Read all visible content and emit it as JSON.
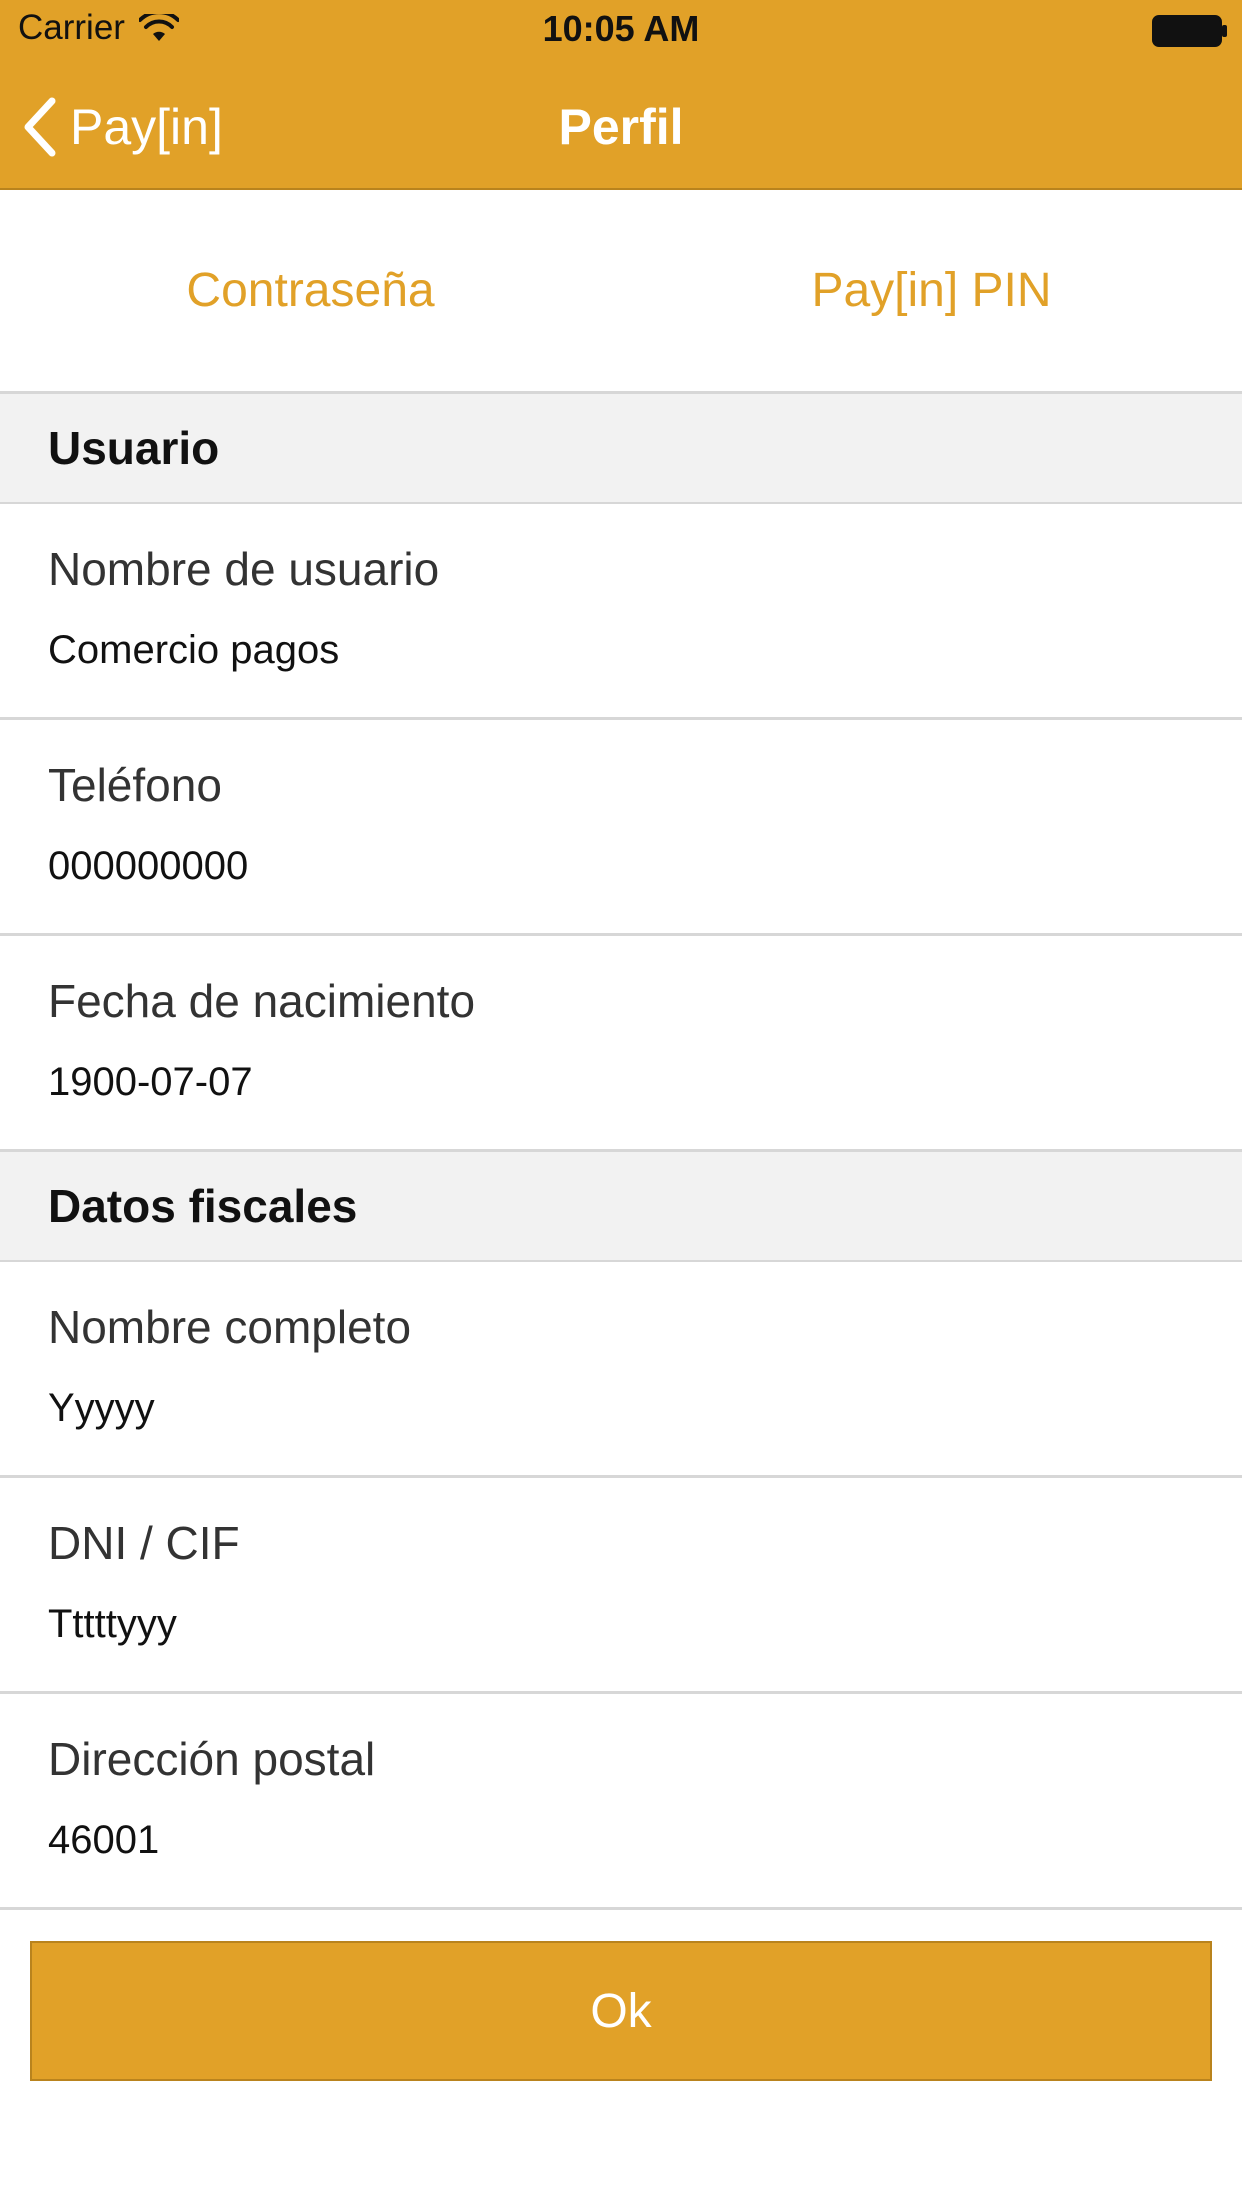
{
  "status_bar": {
    "carrier": "Carrier",
    "time": "10:05 AM",
    "wifi_icon": "wifi-icon",
    "battery_icon": "battery-icon"
  },
  "nav": {
    "back_label": "Pay[in]",
    "back_icon": "chevron-left-icon",
    "title": "Perfil"
  },
  "tabs": [
    {
      "label": "Contraseña"
    },
    {
      "label": "Pay[in] PIN"
    }
  ],
  "sections": [
    {
      "title": "Usuario",
      "rows": [
        {
          "label": "Nombre de usuario",
          "value": "Comercio pagos"
        },
        {
          "label": "Teléfono",
          "value": "000000000"
        },
        {
          "label": "Fecha de nacimiento",
          "value": "1900-07-07"
        }
      ]
    },
    {
      "title": "Datos fiscales",
      "rows": [
        {
          "label": "Nombre completo",
          "value": "Yyyyy"
        },
        {
          "label": "DNI / CIF",
          "value": "Tttttyyy"
        },
        {
          "label": "Dirección postal",
          "value": "46001"
        }
      ]
    }
  ],
  "ok_button": {
    "label": "Ok"
  },
  "colors": {
    "accent": "#E1A128",
    "section_bg": "#F2F2F2",
    "divider": "#D7D7D7"
  }
}
